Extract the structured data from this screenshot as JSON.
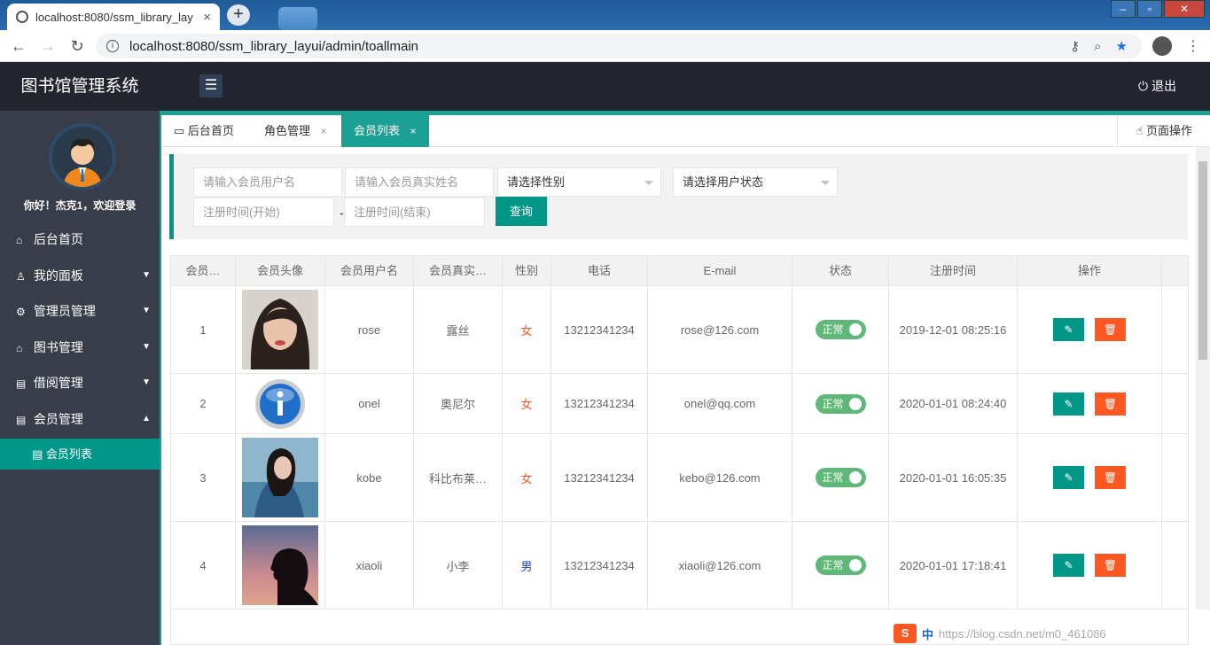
{
  "browser": {
    "tab_title": "localhost:8080/ssm_library_lay",
    "tab_close": "×",
    "new_tab": "+",
    "url": "localhost:8080/ssm_library_layui/admin/toallmain"
  },
  "header": {
    "app_title": "图书馆管理系统",
    "menu_icon": "☰",
    "logout_label": "退出",
    "logout_icon": "⏻"
  },
  "sidebar": {
    "welcome": "你好！杰克1，欢迎登录",
    "items": [
      {
        "label": "后台首页",
        "icon": "⌂",
        "arrow": ""
      },
      {
        "label": "我的面板",
        "icon": "♙",
        "arrow": "▼"
      },
      {
        "label": "管理员管理",
        "icon": "⚙",
        "arrow": "▼"
      },
      {
        "label": "图书管理",
        "icon": "⌂",
        "arrow": "▼"
      },
      {
        "label": "借阅管理",
        "icon": "▤",
        "arrow": "▼"
      },
      {
        "label": "会员管理",
        "icon": "▤",
        "arrow": "▲"
      }
    ],
    "sub_item": {
      "label": "会员列表",
      "icon": "▤"
    }
  },
  "content_tabs": {
    "tabs": [
      {
        "label": "后台首页",
        "icon": "▭"
      },
      {
        "label": "角色管理",
        "close": "×"
      },
      {
        "label": "会员列表",
        "close": "×"
      }
    ],
    "page_ops": "页面操作",
    "page_ops_icon": "☝"
  },
  "search": {
    "username_placeholder": "请输入会员用户名",
    "realname_placeholder": "请输入会员真实姓名",
    "gender_select": "请选择性别",
    "status_select": "请选择用户状态",
    "reg_start_placeholder": "注册时间(开始)",
    "dash": "-",
    "reg_end_placeholder": "注册时间(结束)",
    "query_label": "查询"
  },
  "table": {
    "columns": [
      "会员…",
      "会员头像",
      "会员用户名",
      "会员真实…",
      "性别",
      "电话",
      "E-mail",
      "状态",
      "注册时间",
      "操作"
    ],
    "rows": [
      {
        "id": "1",
        "avatar": "woman-portrait",
        "username": "rose",
        "realname": "露丝",
        "gender": "女",
        "phone": "13212341234",
        "email": "rose@126.com",
        "status": "正常",
        "reg_time": "2019-12-01 08:25:16"
      },
      {
        "id": "2",
        "avatar": "info-icon",
        "username": "onel",
        "realname": "奥尼尔",
        "gender": "女",
        "phone": "13212341234",
        "email": "onel@qq.com",
        "status": "正常",
        "reg_time": "2020-01-01 08:24:40"
      },
      {
        "id": "3",
        "avatar": "girl-seaside",
        "username": "kobe",
        "realname": "科比布莱…",
        "gender": "女",
        "phone": "13212341234",
        "email": "kebo@126.com",
        "status": "正常",
        "reg_time": "2020-01-01 16:05:35"
      },
      {
        "id": "4",
        "avatar": "silhouette-sunset",
        "username": "xiaoli",
        "realname": "小李",
        "gender": "男",
        "phone": "13212341234",
        "email": "xiaoli@126.com",
        "status": "正常",
        "reg_time": "2020-01-01 17:18:41"
      }
    ],
    "edit_icon": "✎",
    "delete_icon": "🗑"
  },
  "ime": {
    "sogou": "S",
    "lang": "中",
    "watermark": "https://blog.csdn.net/m0_461086"
  },
  "colors": {
    "primary": "#009688",
    "header_bg": "#23262e",
    "sidebar_bg": "#393d49",
    "danger": "#ff5722",
    "switch_on": "#5fb878"
  }
}
